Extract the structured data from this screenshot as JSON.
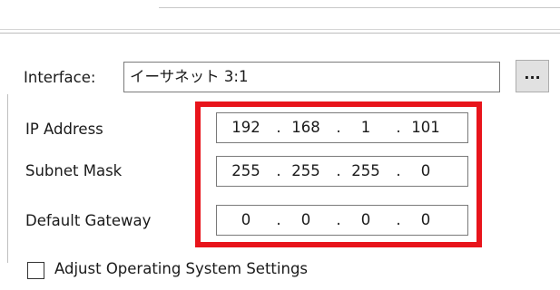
{
  "interface": {
    "label": "Interface:",
    "value": "イーサネット 3:1",
    "browse_label": "..."
  },
  "ip_address": {
    "label": "IP Address",
    "octets": [
      "192",
      "168",
      "1",
      "101"
    ]
  },
  "subnet_mask": {
    "label": "Subnet Mask",
    "octets": [
      "255",
      "255",
      "255",
      "0"
    ]
  },
  "default_gateway": {
    "label": "Default Gateway",
    "octets": [
      "0",
      "0",
      "0",
      "0"
    ]
  },
  "adjust_os_settings": {
    "label": "Adjust Operating System Settings",
    "checked": false
  },
  "colors": {
    "highlight": "#e8141b"
  }
}
